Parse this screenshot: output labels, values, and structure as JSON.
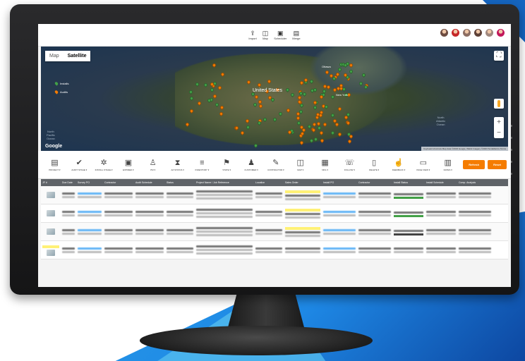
{
  "header": {
    "tools": [
      {
        "icon": "upload-icon",
        "label": "Import"
      },
      {
        "icon": "map-icon",
        "label": "Map"
      },
      {
        "icon": "calendar-icon",
        "label": "Scheduler"
      },
      {
        "icon": "report-icon",
        "label": "Merge"
      }
    ],
    "avatar_colors": [
      "#6d4c41",
      "#c62828",
      "#8d6e63",
      "#5d4037",
      "#a1887f",
      "#c2185b"
    ]
  },
  "map": {
    "tabs": [
      "Map",
      "Satellite"
    ],
    "active_tab": "Satellite",
    "legend": [
      {
        "label": "Installs",
        "color": "#43a047"
      },
      {
        "label": "Audits",
        "color": "#f57c00"
      }
    ],
    "labels": {
      "pacific": "North\nPacific\nOcean",
      "atlantic": "North\nAtlantic\nOcean",
      "country": "United States",
      "ottawa": "Ottawa",
      "newyork": "New York"
    },
    "google": "Google",
    "attribution": "Keyboard shortcuts  Map data ©2023 Google, INEGI  Imagery ©2023 TerraMetrics  Terms",
    "zoom_in": "+",
    "zoom_out": "−",
    "fullscreen": "⛶"
  },
  "toolbar": {
    "tools": [
      {
        "icon": "project-icon",
        "glyph": "▤",
        "label": "PROJECT ▾"
      },
      {
        "icon": "checks-icon",
        "glyph": "✔",
        "label": "AUDIT STAGE ▾"
      },
      {
        "icon": "installers-icon",
        "glyph": "✲",
        "label": "INSTALL STAGE ▾"
      },
      {
        "icon": "calendar-icon",
        "glyph": "▣",
        "label": "EXPIRED ▾"
      },
      {
        "icon": "user-icon",
        "glyph": "♙",
        "label": "PM ▾"
      },
      {
        "icon": "hourglass-icon",
        "glyph": "⧗",
        "label": "AZ STATUS ▾"
      },
      {
        "icon": "list-icon",
        "glyph": "≡",
        "label": "INVENTORY ▾"
      },
      {
        "icon": "sign-icon",
        "glyph": "⚑",
        "label": "STATE ▾"
      },
      {
        "icon": "customer-icon",
        "glyph": "♟",
        "label": "CUSTOMER ▾"
      },
      {
        "icon": "wrench-icon",
        "glyph": "✎",
        "label": "CONTRACTOR ▾"
      },
      {
        "icon": "map-icon",
        "glyph": "◫",
        "label": "MAP ▾"
      },
      {
        "icon": "keyboard-icon",
        "glyph": "▦",
        "label": "NFG ▾"
      },
      {
        "icon": "phone-icon",
        "glyph": "☏",
        "label": "FOLLOW ▾"
      },
      {
        "icon": "document-icon",
        "glyph": "▯",
        "label": "DELETE ▾"
      },
      {
        "icon": "thumb-icon",
        "glyph": "☝",
        "label": "FEEDBACK ▾"
      },
      {
        "icon": "monitor-icon",
        "glyph": "▭",
        "label": "PAGE VIEW ▾"
      },
      {
        "icon": "calendar2-icon",
        "glyph": "▥",
        "label": "DATES ▾"
      }
    ],
    "refresh_label": "Refresh",
    "reset_label": "Reset"
  },
  "table": {
    "headers": [
      "JF #",
      "Due Date",
      "Survey PO",
      "Contractor",
      "Audit Schedule",
      "Status",
      "Project Name / Job Reference",
      "Location",
      "Sales Order",
      "Install PO",
      "Contractor",
      "Install Status",
      "Install Schedule",
      "Comp. Analysis"
    ]
  }
}
